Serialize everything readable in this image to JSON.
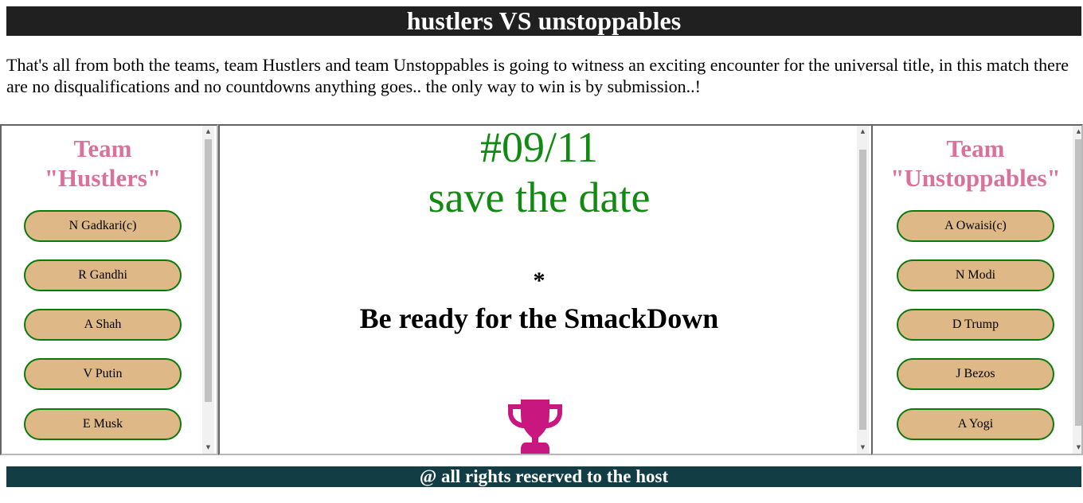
{
  "header": {
    "title": "hustlers VS unstoppables"
  },
  "intro": {
    "text": "That's all from both the teams, team Hustlers and team Unstoppables is going to witness an exciting encounter for the universal title, in this match there are no disqualifications and no countdowns anything goes.. the only way to win is by submission..!"
  },
  "left_team": {
    "title_line1": "Team",
    "title_line2": "\"Hustlers\"",
    "members": [
      "N Gadkari(c)",
      "R Gandhi",
      "A Shah",
      "V Putin",
      "E Musk"
    ]
  },
  "center": {
    "date": "#09/11",
    "save_the_date": "save the date",
    "asterisk": "*",
    "tagline": "Be ready for the SmackDown",
    "trophy_icon": "trophy-icon"
  },
  "right_team": {
    "title_line1": "Team",
    "title_line2": "\"Unstoppables\"",
    "members": [
      "A Owaisi(c)",
      "N Modi",
      "D Trump",
      "J Bezos",
      "A Yogi"
    ]
  },
  "footer": {
    "text": "@ all rights reserved to the host"
  },
  "colors": {
    "header_bg": "#202020",
    "team_title": "#d9719b",
    "button_fill": "#deb887",
    "button_border": "#0b7a0b",
    "date_text": "#118a11",
    "trophy": "#c8177e",
    "footer_bg": "#123d44"
  }
}
